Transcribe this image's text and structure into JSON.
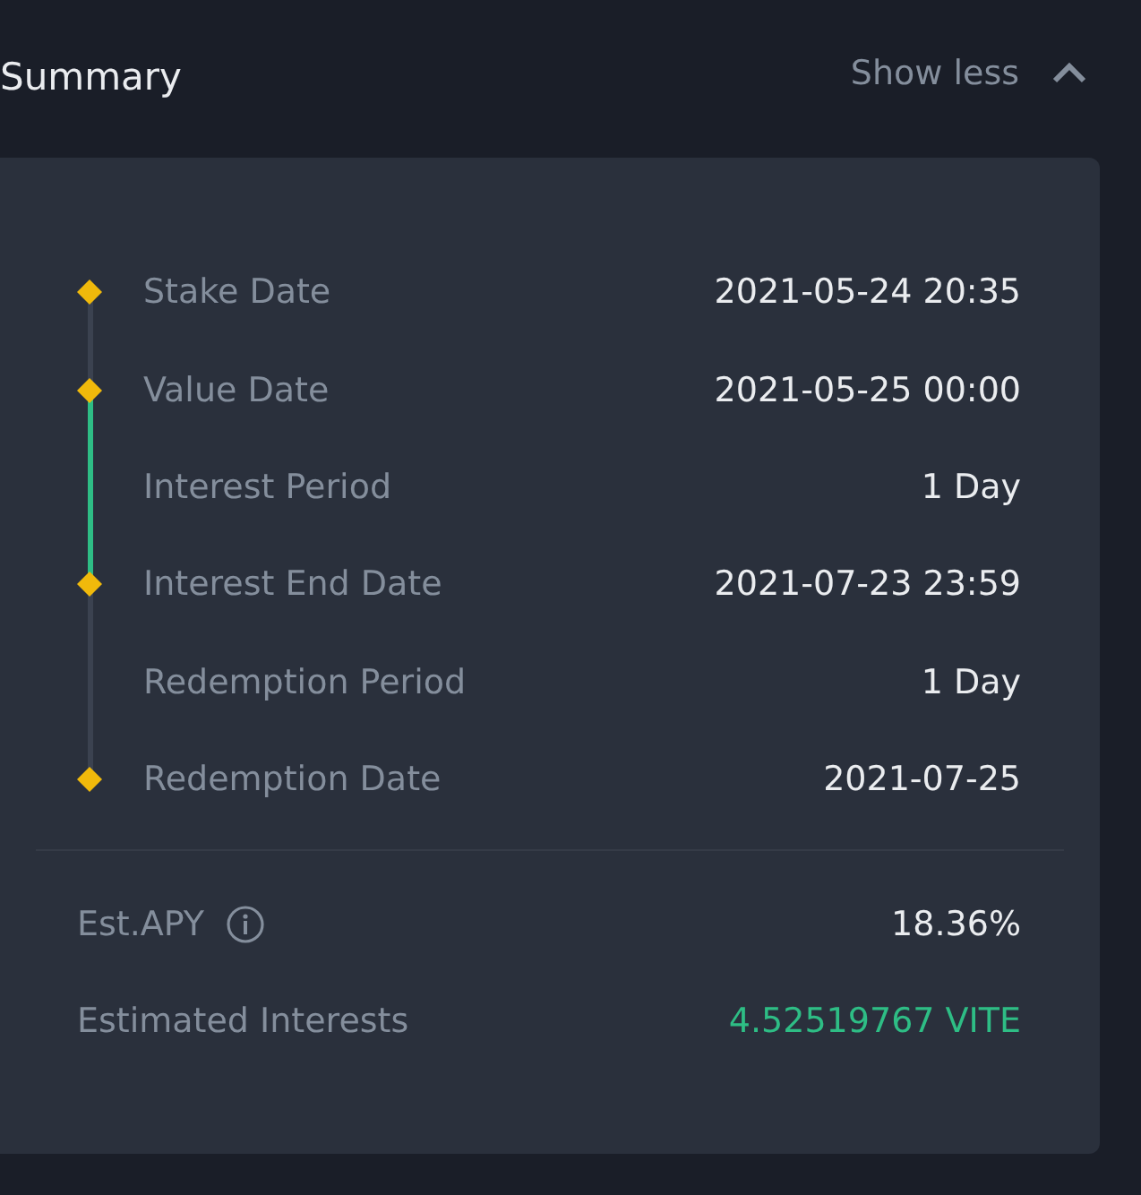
{
  "header": {
    "title": "Summary",
    "toggle": "Show less",
    "expanded": true
  },
  "timeline": [
    {
      "kind": "milestone",
      "label": "Stake Date",
      "value": "2021-05-24 20:35",
      "highlighted": false
    },
    {
      "kind": "milestone",
      "label": "Value Date",
      "value": "2021-05-25 00:00",
      "highlighted": true
    },
    {
      "kind": "period",
      "label": "Interest Period",
      "value": "1 Day",
      "highlighted": true
    },
    {
      "kind": "milestone",
      "label": "Interest End Date",
      "value": "2021-07-23 23:59",
      "highlighted": false
    },
    {
      "kind": "period",
      "label": "Redemption Period",
      "value": "1 Day",
      "highlighted": false
    },
    {
      "kind": "milestone",
      "label": "Redemption Date",
      "value": "2021-07-25"
    }
  ],
  "totals": [
    {
      "label": "Est.APY",
      "info": true,
      "value": "18.36%",
      "positive": false
    },
    {
      "label": "Estimated Interests",
      "value": "4.52519767 VITE",
      "positive": true
    }
  ]
}
